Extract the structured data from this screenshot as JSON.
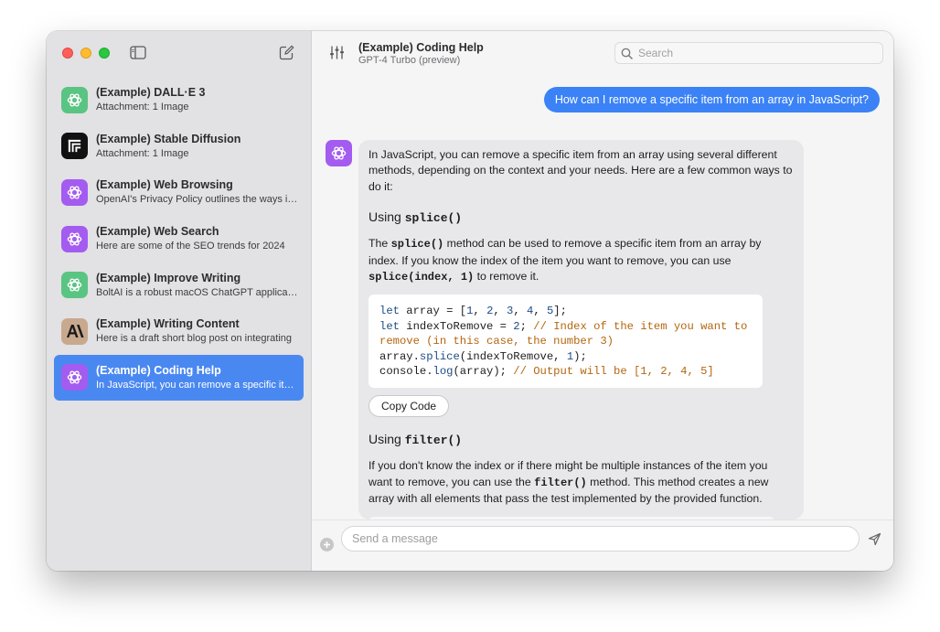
{
  "sidebar": {
    "items": [
      {
        "title": "(Example) DALL·E 3",
        "subtitle": "Attachment: 1 Image",
        "icon": "openai-logo-icon",
        "icon_color": "#5ac483"
      },
      {
        "title": "(Example) Stable Diffusion",
        "subtitle": "Attachment: 1 Image",
        "icon": "stable-diffusion-logo-icon",
        "icon_color": "#111111"
      },
      {
        "title": "(Example) Web Browsing",
        "subtitle": "OpenAI's Privacy Policy outlines the ways in which OpenAI collects",
        "icon": "openai-logo-icon",
        "icon_color": "#a45cf0"
      },
      {
        "title": "(Example) Web Search",
        "subtitle": "Here are some of the SEO trends for 2024",
        "icon": "openai-logo-icon",
        "icon_color": "#a45cf0"
      },
      {
        "title": "(Example) Improve Writing",
        "subtitle": "BoltAI is a robust macOS ChatGPT application",
        "icon": "openai-logo-icon",
        "icon_color": "#5ac483"
      },
      {
        "title": "(Example) Writing Content",
        "subtitle": "Here is a draft short blog post on integrating",
        "icon": "anthropic-logo-icon",
        "icon_color": "#c8a98e"
      },
      {
        "title": "(Example) Coding Help",
        "subtitle": "In JavaScript, you can remove a specific item from an array",
        "icon": "openai-logo-icon",
        "icon_color": "#a45cf0",
        "active": true
      }
    ]
  },
  "header": {
    "title": "(Example) Coding Help",
    "model": "GPT-4 Turbo (preview)",
    "search_placeholder": "Search"
  },
  "messages": {
    "user": "How can I remove a specific item from an array in JavaScript?",
    "assistant": {
      "intro": "In JavaScript, you can remove a specific item from an array using several different methods, depending on the context and your needs. Here are a few common ways to do it:",
      "h_splice_prefix": "Using ",
      "h_splice_code": "splice()",
      "splice_p1_a": "The ",
      "splice_p1_code": "splice()",
      "splice_p1_b": " method can be used to remove a specific item from an array by index. If you know the index of the item you want to remove, you can use ",
      "splice_p1_code2": "splice(index, 1)",
      "splice_p1_c": " to remove it.",
      "code_lines": [
        "let array = [1, 2, 3, 4, 5];",
        "let indexToRemove = 2; // Index of the item you want to remove (in this case, the number 3)",
        "array.splice(indexToRemove, 1);",
        "console.log(array); // Output will be [1, 2, 4, 5]"
      ],
      "copy_label": "Copy Code",
      "h_filter_prefix": "Using ",
      "h_filter_code": "filter()",
      "filter_p_a": "If you don't know the index or if there might be multiple instances of the item you want to remove, you can use the ",
      "filter_p_code": "filter()",
      "filter_p_b": " method. This method creates a new array with all elements that pass the test implemented by the provided function."
    }
  },
  "composer": {
    "placeholder": "Send a message"
  },
  "colors": {
    "accent": "#3b82f6",
    "selected": "#4a88f1",
    "comment": "#b4660f"
  }
}
